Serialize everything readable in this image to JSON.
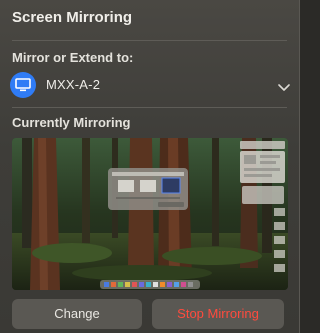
{
  "panel": {
    "title": "Screen Mirroring",
    "mirror_label": "Mirror or Extend to:",
    "device": {
      "name": "MXX-A-2",
      "icon": "display-icon",
      "icon_color": "#2f7cf6"
    },
    "current_label": "Currently Mirroring",
    "preview": {
      "description_icon": "mirrored-screen-thumbnail"
    },
    "buttons": {
      "change": "Change",
      "stop": "Stop Mirroring"
    }
  },
  "colors": {
    "accent": "#2f7cf6",
    "stop_text": "#ff4b3e"
  }
}
